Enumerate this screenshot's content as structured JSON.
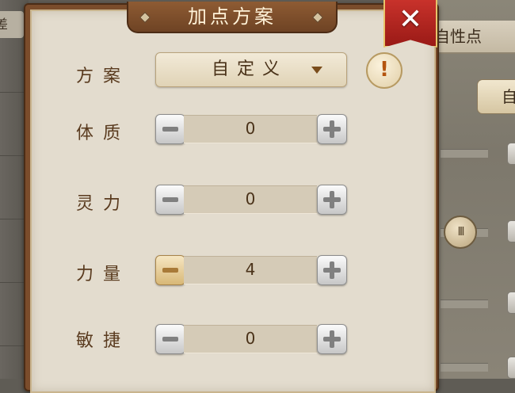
{
  "background": {
    "left_tab_text": "差",
    "right_tab_text": "自性点",
    "right_button_text": "自",
    "knob_glyph": "III"
  },
  "dialog": {
    "title": "加点方案",
    "close_glyph": "✕",
    "scheme": {
      "label": "方案",
      "selected": "自定义"
    },
    "info_glyph": "!",
    "attributes": [
      {
        "label": "体质",
        "value": "0"
      },
      {
        "label": "灵力",
        "value": "0"
      },
      {
        "label": "力量",
        "value": "4"
      },
      {
        "label": "敏捷",
        "value": "0"
      }
    ]
  },
  "colors": {
    "frame": "#7a4c2b",
    "panel": "#e3dcce",
    "text_brown": "#5a3b1f",
    "close_red": "#b0241f",
    "info_orange": "#b4540e"
  }
}
